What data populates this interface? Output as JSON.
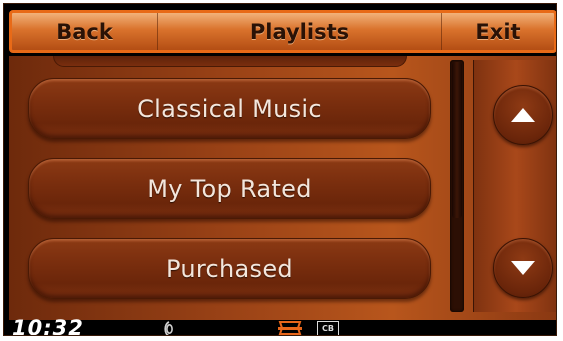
{
  "header": {
    "back_label": "Back",
    "title": "Playlists",
    "exit_label": "Exit"
  },
  "playlists": [
    {
      "label": "Classical Music"
    },
    {
      "label": "My Top Rated"
    },
    {
      "label": "Purchased"
    }
  ],
  "status_bar": {
    "clock": "10:32",
    "cb_label": "CB",
    "icons": [
      "signal-icon",
      "brand-logo-icon"
    ]
  },
  "colors": {
    "header_border": "#e86a17",
    "header_fill": "#d9722c",
    "button_fill": "#7a2e0e",
    "arrow_fill": "#ffffff"
  }
}
